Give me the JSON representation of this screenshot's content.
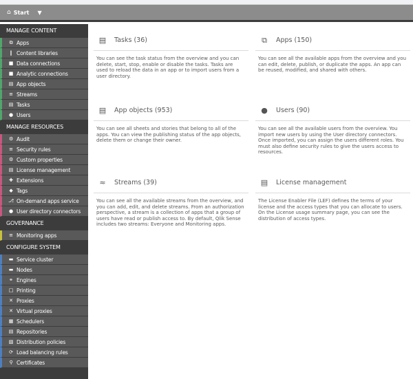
{
  "topbar": {
    "home_icon": "home-icon",
    "start_label": "Start",
    "caret_icon": "caret-down-icon"
  },
  "accent_colors": {
    "manage_content": "#52a56b",
    "manage_resources": "#c9577f",
    "governance": "#c8c23e",
    "configure_system": "#4e7fbf"
  },
  "sidebar": {
    "sections": [
      {
        "title": "MANAGE CONTENT",
        "items": [
          {
            "label": "Apps",
            "icon": "apps-icon"
          },
          {
            "label": "Content libraries",
            "icon": "content-libraries-icon"
          },
          {
            "label": "Data connections",
            "icon": "data-connections-icon"
          },
          {
            "label": "Analytic connections",
            "icon": "analytic-connections-icon"
          },
          {
            "label": "App objects",
            "icon": "app-objects-icon"
          },
          {
            "label": "Streams",
            "icon": "streams-icon"
          },
          {
            "label": "Tasks",
            "icon": "tasks-icon"
          },
          {
            "label": "Users",
            "icon": "users-icon"
          }
        ]
      },
      {
        "title": "MANAGE RESOURCES",
        "items": [
          {
            "label": "Audit",
            "icon": "audit-icon"
          },
          {
            "label": "Security rules",
            "icon": "security-rules-icon"
          },
          {
            "label": "Custom properties",
            "icon": "custom-properties-icon"
          },
          {
            "label": "License management",
            "icon": "license-icon"
          },
          {
            "label": "Extensions",
            "icon": "extensions-icon"
          },
          {
            "label": "Tags",
            "icon": "tags-icon"
          },
          {
            "label": "On-demand apps service",
            "icon": "on-demand-icon"
          },
          {
            "label": "User directory connectors",
            "icon": "user-directory-icon"
          }
        ]
      },
      {
        "title": "GOVERNANCE",
        "items": [
          {
            "label": "Monitoring apps",
            "icon": "monitoring-apps-icon"
          }
        ]
      },
      {
        "title": "CONFIGURE SYSTEM",
        "items": [
          {
            "label": "Service cluster",
            "icon": "service-cluster-icon"
          },
          {
            "label": "Nodes",
            "icon": "nodes-icon"
          },
          {
            "label": "Engines",
            "icon": "engines-icon"
          },
          {
            "label": "Printing",
            "icon": "printing-icon"
          },
          {
            "label": "Proxies",
            "icon": "proxies-icon"
          },
          {
            "label": "Virtual proxies",
            "icon": "virtual-proxies-icon"
          },
          {
            "label": "Schedulers",
            "icon": "schedulers-icon"
          },
          {
            "label": "Repositories",
            "icon": "repositories-icon"
          },
          {
            "label": "Distribution policies",
            "icon": "distribution-policies-icon"
          },
          {
            "label": "Load balancing rules",
            "icon": "load-balancing-icon"
          },
          {
            "label": "Certificates",
            "icon": "certificates-icon"
          }
        ]
      }
    ]
  },
  "cards": [
    {
      "title": "Tasks (36)",
      "icon": "tasks-icon",
      "description": "You can see the task status from the overview and you can delete, start, stop, enable or disable the tasks. Tasks are used to reload the data in an app or to import users from a user directory."
    },
    {
      "title": "Apps (150)",
      "icon": "apps-icon",
      "description": "You can see all the available apps from the overview and you can edit, delete, publish, or duplicate the apps. An app can be reused, modified, and shared with others."
    },
    {
      "title": "App objects (953)",
      "icon": "app-objects-icon",
      "description": "You can see all sheets and stories that belong to all of the apps. You can view the publishing status of the app objects, delete them or change their owner."
    },
    {
      "title": "Users (90)",
      "icon": "users-icon",
      "description": "You can see all the available users from the overview. You import new users by using the User directory connectors. Once imported, you can assign the users different roles. You must also define security rules to give the users access to resources."
    },
    {
      "title": "Streams (39)",
      "icon": "streams-icon",
      "description": "You can see all the available streams from the overview, and you can add, edit, and delete streams. From an authorization perspective, a stream is a collection of apps that a group of users have read or publish access to. By default, Qlik Sense includes two streams: Everyone and Monitoring apps."
    },
    {
      "title": "License management",
      "icon": "license-icon",
      "description": "The License Enabler File (LEF) defines the terms of your license and the access types that you can allocate to users. On the License usage summary page, you can see the distribution of access types."
    }
  ]
}
